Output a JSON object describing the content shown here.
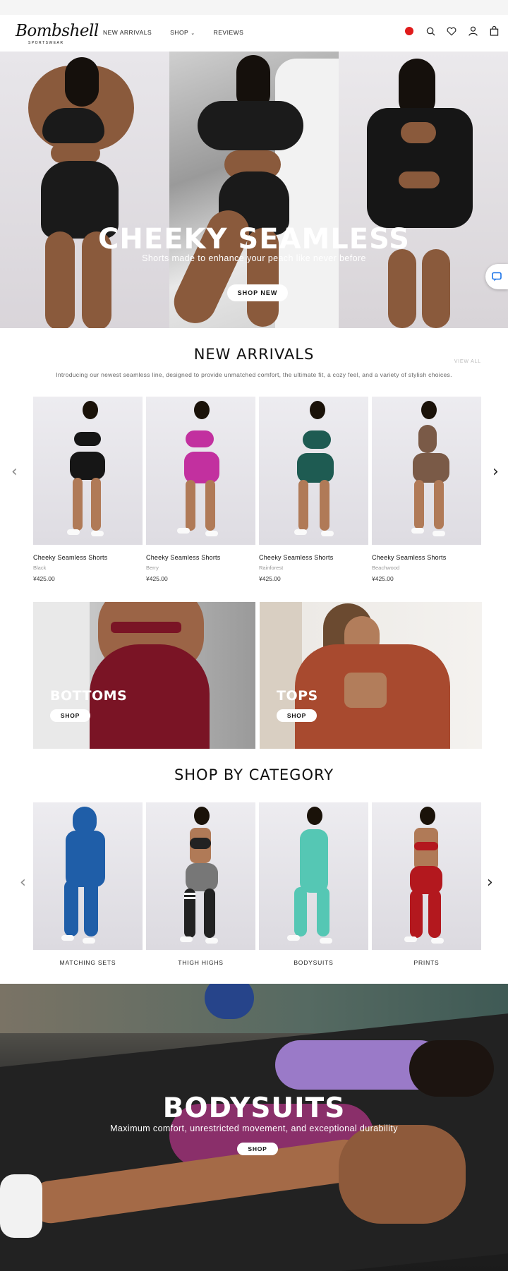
{
  "header": {
    "logo": "Bombshell",
    "logo_sub": "SPORTSWEAR",
    "nav": [
      "NEW ARRIVALS",
      "SHOP",
      "REVIEWS"
    ],
    "icons": [
      "region-flag-icon",
      "search-icon",
      "heart-icon",
      "user-icon",
      "bag-icon"
    ]
  },
  "hero": {
    "title": "CHEEKY SEAMLESS",
    "subtitle": "Shorts made to enhance your peach like never before",
    "button": "SHOP NEW"
  },
  "new_arrivals": {
    "title": "NEW ARRIVALS",
    "view_all": "VIEW ALL",
    "description": "Introducing our newest seamless line, designed to provide unmatched comfort, the ultimate fit, a cozy feel, and a variety of stylish choices.",
    "products": [
      {
        "name": "Cheeky Seamless Shorts",
        "color": "Black",
        "price": "¥425.00",
        "swatch": "#161616"
      },
      {
        "name": "Cheeky Seamless Shorts",
        "color": "Berry",
        "price": "¥425.00",
        "swatch": "#c2309f"
      },
      {
        "name": "Cheeky Seamless Shorts",
        "color": "Rainforest",
        "price": "¥425.00",
        "swatch": "#1e5b52"
      },
      {
        "name": "Cheeky Seamless Shorts",
        "color": "Beachwood",
        "price": "¥425.00",
        "swatch": "#7a5a47"
      }
    ]
  },
  "promos": [
    {
      "title": "BOTTOMS",
      "button": "SHOP"
    },
    {
      "title": "TOPS",
      "button": "SHOP"
    }
  ],
  "shop_by_category": {
    "title": "SHOP BY CATEGORY",
    "categories": [
      {
        "label": "MATCHING SETS",
        "swatch": "#1f5ea8"
      },
      {
        "label": "THIGH HIGHS",
        "swatch": "#222222"
      },
      {
        "label": "BODYSUITS",
        "swatch": "#55c7b4"
      },
      {
        "label": "PRINTS",
        "swatch": "#b3181e"
      }
    ]
  },
  "banner": {
    "title": "BODYSUITS",
    "subtitle": "Maximum comfort, unrestricted movement, and exceptional durability",
    "button": "SHOP"
  }
}
